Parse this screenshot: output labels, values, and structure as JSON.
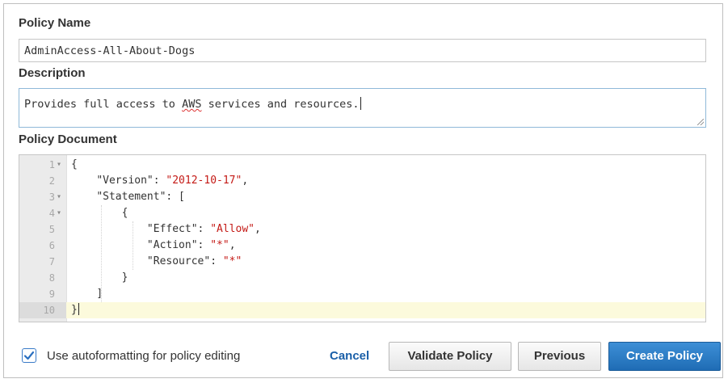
{
  "form": {
    "policy_name_label": "Policy Name",
    "policy_name_value": "AdminAccess-All-About-Dogs",
    "description_label": "Description",
    "description_prefix": "Provides full access to ",
    "description_spell_word": "AWS",
    "description_suffix": " services and resources.",
    "policy_document_label": "Policy Document"
  },
  "editor": {
    "line_numbers": [
      "1",
      "2",
      "3",
      "4",
      "5",
      "6",
      "7",
      "8",
      "9",
      "10"
    ],
    "fold_markers": [
      "▾",
      "",
      "▾",
      "▾",
      "",
      "",
      "",
      "",
      "",
      ""
    ],
    "tokens": {
      "brace_open": "{",
      "version_key": "\"Version\": ",
      "version_val": "\"2012-10-17\"",
      "comma": ",",
      "statement_key": "\"Statement\": [",
      "inner_open": "{",
      "effect_key": "\"Effect\": ",
      "effect_val": "\"Allow\"",
      "action_key": "\"Action\": ",
      "action_val": "\"*\"",
      "resource_key": "\"Resource\": ",
      "resource_val": "\"*\"",
      "inner_close": "}",
      "bracket_close": "]",
      "brace_close": "}"
    }
  },
  "footer": {
    "autoformat_label": "Use autoformatting for policy editing",
    "autoformat_checked": true,
    "cancel_label": "Cancel",
    "validate_label": "Validate Policy",
    "previous_label": "Previous",
    "create_label": "Create Policy"
  },
  "colors": {
    "primary_button": "#2a7bc4",
    "string_literal": "#c41a16",
    "active_line": "#fcfadc",
    "link": "#1a5fa8"
  }
}
